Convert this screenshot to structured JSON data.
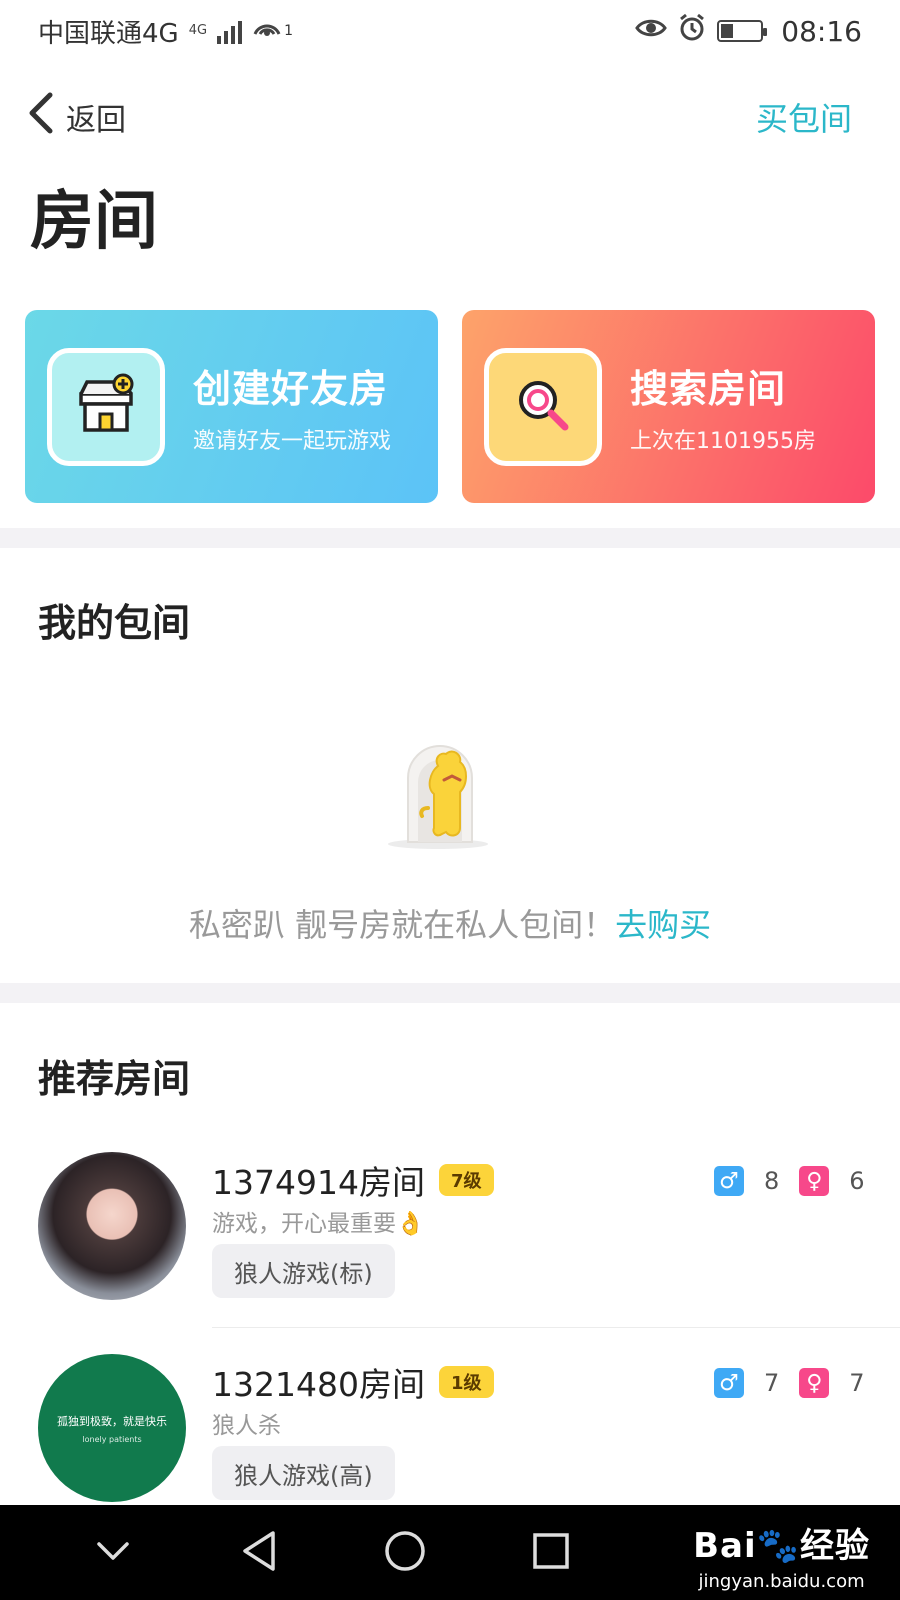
{
  "status_bar": {
    "carrier": "中国联通4G",
    "net_sup": "4G",
    "hotspot_count": "1",
    "time": "08:16"
  },
  "nav": {
    "back_label": "返回",
    "buy_room_label": "买包间"
  },
  "page_title": "房间",
  "cards": {
    "create": {
      "title": "创建好友房",
      "subtitle": "邀请好友一起玩游戏"
    },
    "search": {
      "title": "搜索房间",
      "subtitle": "上次在1101955房"
    }
  },
  "my_rooms": {
    "title": "我的包间",
    "empty_text": "私密趴 靓号房就在私人包间！",
    "buy_link": "去购买"
  },
  "recommended": {
    "title": "推荐房间",
    "rooms": [
      {
        "name": "1374914房间",
        "level": "7级",
        "desc": "游戏，开心最重要👌",
        "tag": "狼人游戏(标)",
        "male": "8",
        "female": "6"
      },
      {
        "name": "1321480房间",
        "level": "1级",
        "desc": "狼人杀",
        "tag": "狼人游戏(高)",
        "male": "7",
        "female": "7",
        "avatar_line1": "孤独到极致，就是快乐",
        "avatar_line2": "lonely patients"
      }
    ]
  },
  "watermark": {
    "main": "Bai🐾经验",
    "sub": "jingyan.baidu.com"
  },
  "colors": {
    "accent": "#2bb7c9",
    "level_badge": "#fcd43a",
    "male": "#3fa9f5",
    "female": "#f7488a"
  }
}
